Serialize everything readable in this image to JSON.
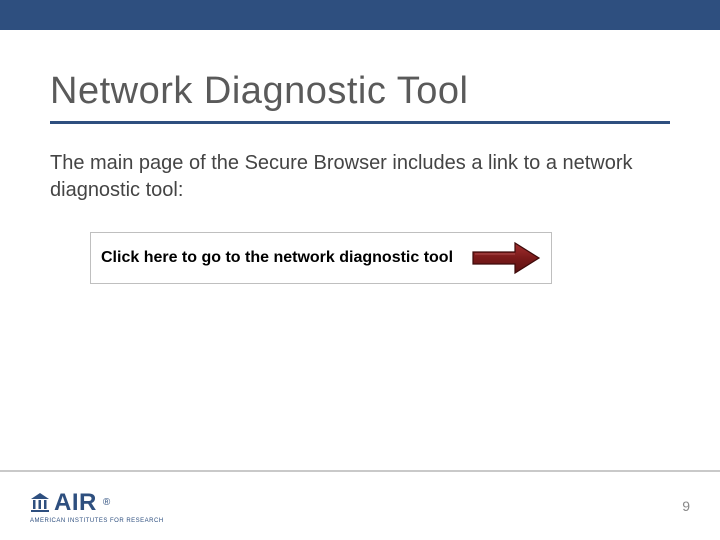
{
  "header": {
    "title": "Network Diagnostic Tool"
  },
  "body": {
    "intro": "The main page of the Secure Browser includes a link to a network diagnostic tool:",
    "diag_link_text": "Click here to go to the network diagnostic tool"
  },
  "footer": {
    "logo_text": "AIR",
    "logo_reg": "®",
    "logo_sub": "AMERICAN INSTITUTES FOR RESEARCH",
    "page_number": "9"
  },
  "colors": {
    "brand_blue": "#2e4f7f",
    "arrow_fill": "#7a1a1a",
    "arrow_stroke": "#4a0f0f"
  }
}
